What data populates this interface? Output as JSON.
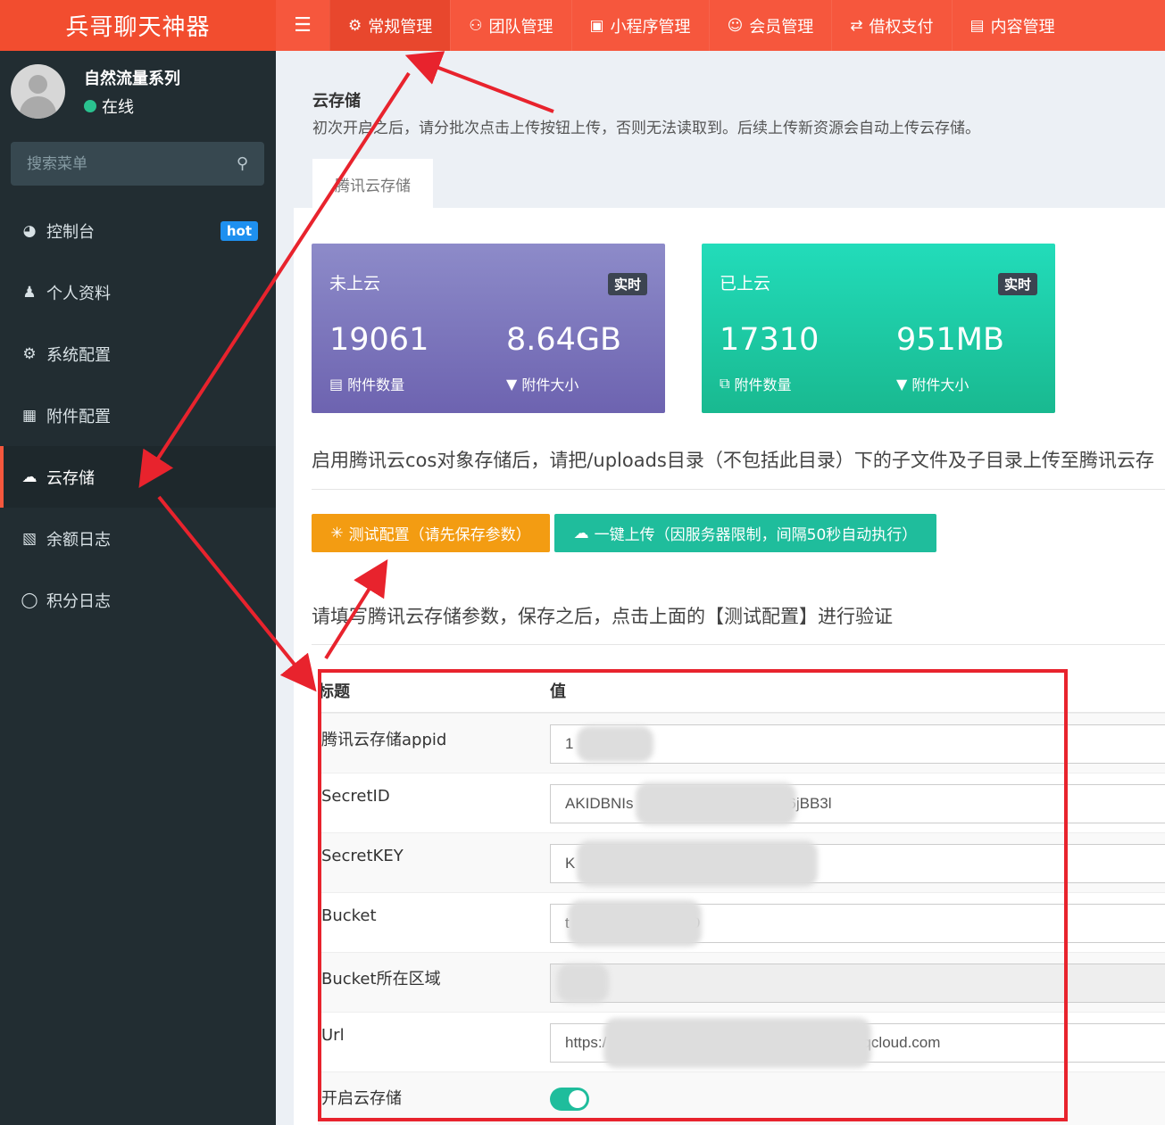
{
  "brand": "兵哥聊天神器",
  "topnav": {
    "items": [
      {
        "label": "常规管理",
        "icon": "cogs-icon"
      },
      {
        "label": "团队管理",
        "icon": "users-icon"
      },
      {
        "label": "小程序管理",
        "icon": "miniprogram-icon"
      },
      {
        "label": "会员管理",
        "icon": "user-circle-icon"
      },
      {
        "label": "借权支付",
        "icon": "exchange-icon"
      },
      {
        "label": "内容管理",
        "icon": "newspaper-icon"
      }
    ]
  },
  "sidebar": {
    "user_name": "自然流量系列",
    "user_status": "在线",
    "search_placeholder": "搜索菜单",
    "items": [
      {
        "label": "控制台",
        "icon": "dashboard-icon",
        "badge": "hot"
      },
      {
        "label": "个人资料",
        "icon": "user-icon"
      },
      {
        "label": "系统配置",
        "icon": "gear-icon"
      },
      {
        "label": "附件配置",
        "icon": "file-image-icon"
      },
      {
        "label": "云存储",
        "icon": "cloud-upload-icon",
        "active": true
      },
      {
        "label": "余额日志",
        "icon": "money-icon"
      },
      {
        "label": "积分日志",
        "icon": "circle-icon"
      }
    ]
  },
  "header": {
    "title": "云存储",
    "description": "初次开启之后，请分批次点击上传按钮上传，否则无法读取到。后续上传新资源会自动上传云存储。",
    "tab": "腾讯云存储"
  },
  "stats": [
    {
      "title": "未上云",
      "badge": "实时",
      "count": "19061",
      "count_label": "附件数量",
      "size": "8.64GB",
      "size_label": "附件大小",
      "color": "#7a72bb"
    },
    {
      "title": "已上云",
      "badge": "实时",
      "count": "17310",
      "count_label": "附件数量",
      "size": "951MB",
      "size_label": "附件大小",
      "color": "#1ccba6"
    }
  ],
  "notice": "启用腾讯云cos对象存储后，请把/uploads目录（不包括此目录）下的子文件及子目录上传至腾讯云存",
  "buttons": {
    "test": "测试配置（请先保存参数）",
    "upload": "一键上传（因服务器限制，间隔50秒自动执行）"
  },
  "form_notice": "请填写腾讯云存储参数，保存之后，点击上面的【测试配置】进行验证",
  "table": {
    "col_title": "标题",
    "col_value": "值",
    "rows": [
      {
        "label": "腾讯云存储appid",
        "value": "1"
      },
      {
        "label": "SecretID",
        "value": "AKIDBNIs                    MyZ0vd7J6jBB3l"
      },
      {
        "label": "SecretKEY",
        "value": "K                                          2uWrv"
      },
      {
        "label": "Bucket",
        "value": "t                       2630"
      },
      {
        "label": "Bucket所在区域",
        "value": ""
      },
      {
        "label": "Url",
        "value": "https:/                                                   ng.myqcloud.com"
      },
      {
        "label": "开启云存储",
        "value": "on"
      }
    ]
  },
  "colors": {
    "accent": "#f6573d",
    "sidebar": "#222d32",
    "orange": "#f39c12",
    "teal": "#1fbd9c",
    "annotation": "#e8232d"
  }
}
